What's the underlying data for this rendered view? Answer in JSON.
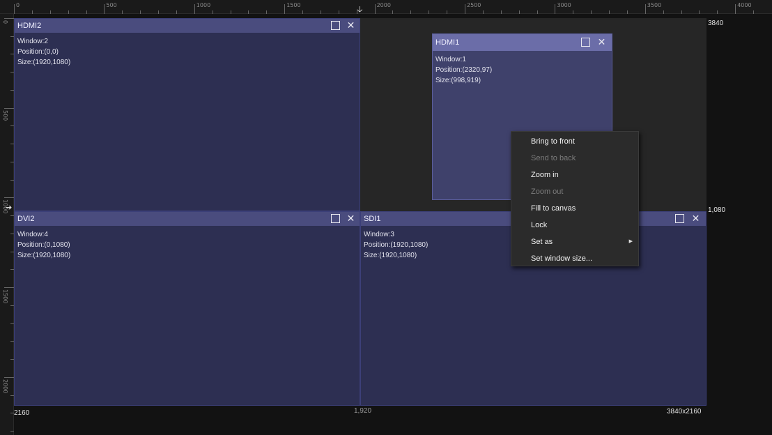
{
  "ruler": {
    "top_labels": [
      "0",
      "500",
      "1000",
      "1500",
      "2000",
      "2500",
      "3000",
      "3500",
      "4000"
    ],
    "left_labels": [
      "0",
      "500",
      "1000",
      "1500",
      "2000"
    ]
  },
  "canvas": {
    "width_label": "3840",
    "height_label": "1,080",
    "mid_label": "1,920",
    "bottom_left_label": "2160",
    "size_label": "3840x2160"
  },
  "windows": [
    {
      "title": "HDMI2",
      "window": "Window:2",
      "position": "Position:(0,0)",
      "size": "Size:(1920,1080)"
    },
    {
      "title": "HDMI1",
      "window": "Window:1",
      "position": "Position:(2320,97)",
      "size": "Size:(998,919)"
    },
    {
      "title": "DVI2",
      "window": "Window:4",
      "position": "Position:(0,1080)",
      "size": "Size:(1920,1080)"
    },
    {
      "title": "SDI1",
      "window": "Window:3",
      "position": "Position:(1920,1080)",
      "size": "Size:(1920,1080)"
    }
  ],
  "context_menu": {
    "items": [
      {
        "label": "Bring to front",
        "enabled": true
      },
      {
        "label": "Send to back",
        "enabled": false
      },
      {
        "label": "Zoom in",
        "enabled": true
      },
      {
        "label": "Zoom out",
        "enabled": false
      },
      {
        "label": "Fill to canvas",
        "enabled": true
      },
      {
        "label": "Lock",
        "enabled": true
      },
      {
        "label": "Set as",
        "enabled": true,
        "submenu": true
      },
      {
        "label": "Set window size...",
        "enabled": true
      }
    ]
  },
  "icons": {
    "maximize": "maximize-icon",
    "close": "close-icon",
    "submenu": "submenu-arrow-icon",
    "position_marker": "down-arrow-icon"
  },
  "colors": {
    "canvas_bg": "#262626",
    "window_bg": "#2d2f52",
    "window_title": "#4a4c7e",
    "menu_bg": "#2b2b2b"
  }
}
